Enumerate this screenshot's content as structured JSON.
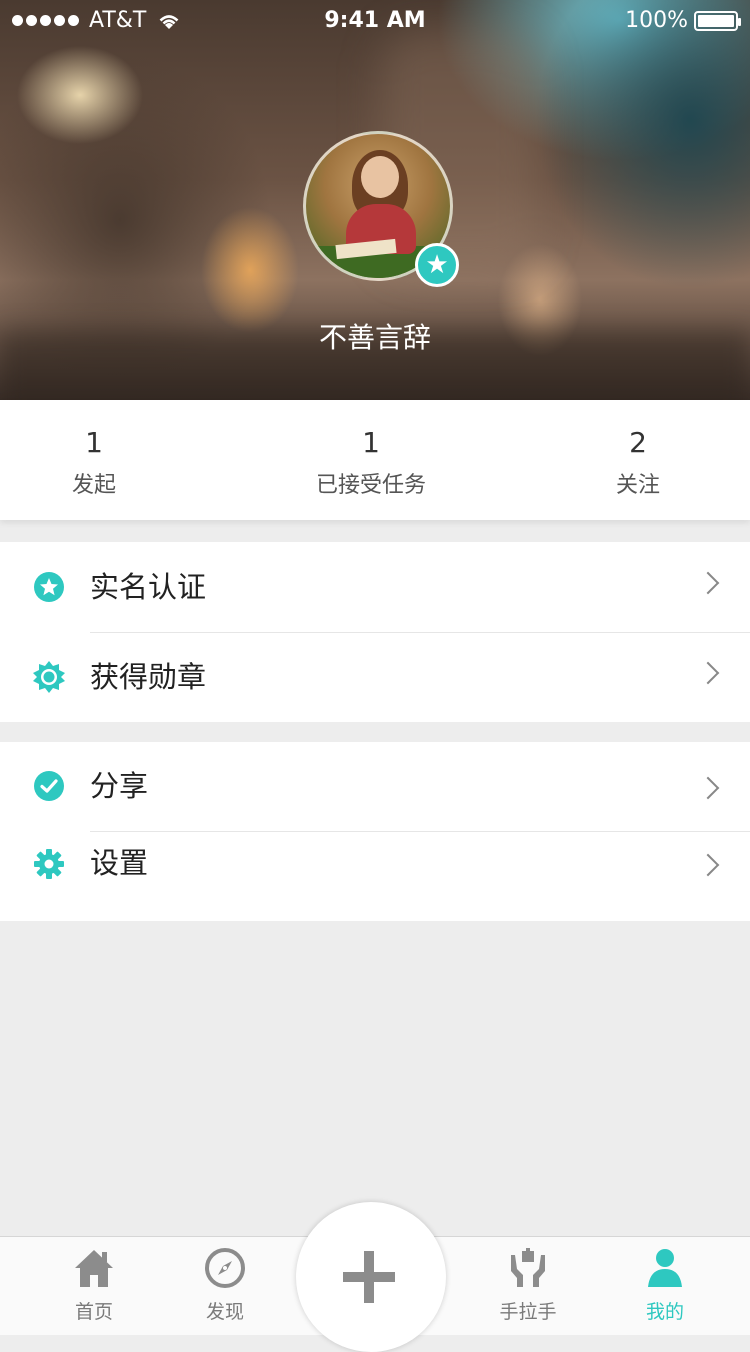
{
  "status_bar": {
    "carrier": "AT&T",
    "time": "9:41 AM",
    "battery": "100%"
  },
  "profile": {
    "username": "不善言辞"
  },
  "stats": [
    {
      "value": "1",
      "label": "发起"
    },
    {
      "value": "1",
      "label": "已接受任务"
    },
    {
      "value": "2",
      "label": "关注"
    }
  ],
  "menu": {
    "group1": [
      {
        "label": "实名认证",
        "icon": "star-badge-icon"
      },
      {
        "label": "获得勋章",
        "icon": "sun-icon"
      }
    ],
    "group2": [
      {
        "label": "分享",
        "icon": "check-circle-icon"
      },
      {
        "label": "设置",
        "icon": "gear-icon"
      }
    ]
  },
  "tabbar": {
    "items": [
      {
        "label": "首页",
        "icon": "home-icon"
      },
      {
        "label": "发现",
        "icon": "compass-icon"
      },
      {
        "label": "手拉手",
        "icon": "hands-gift-icon"
      },
      {
        "label": "我的",
        "icon": "person-icon"
      }
    ],
    "active_color": "#2ec8c0",
    "center_action": "plus-icon"
  },
  "colors": {
    "accent": "#2ec8c0",
    "background": "#ededed"
  }
}
